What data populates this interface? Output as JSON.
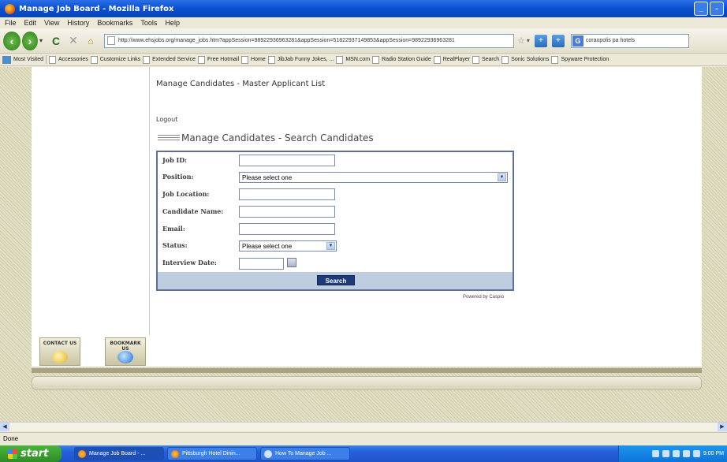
{
  "window": {
    "title": "Manage Job Board - Mozilla Firefox"
  },
  "menu": [
    "File",
    "Edit",
    "View",
    "History",
    "Bookmarks",
    "Tools",
    "Help"
  ],
  "address": {
    "url": "http://www.ehsjobs.org/manage_jobs.htm?appSession=98922936963281&appSession=51822937149853&appSession=98922936963281",
    "search": "coraopolis pa hotels"
  },
  "bookmarks": [
    "Most Visited",
    "Accessories",
    "Customize Links",
    "Extended Service",
    "Free Hotmail",
    "Home",
    "JibJab Funny Jokes, ...",
    "MSN.com",
    "Radio Station Guide",
    "RealPlayer",
    "Search",
    "Sonic Solutions",
    "Spyware Protection"
  ],
  "page": {
    "header": "Manage Candidates - Master Applicant List",
    "logout": "Logout",
    "section_title": "Manage Candidates - Search Candidates",
    "form": {
      "job_id_label": "Job ID:",
      "position_label": "Position:",
      "position_value": "Please select one",
      "location_label": "Job Location:",
      "candidate_label": "Candidate Name:",
      "email_label": "Email:",
      "status_label": "Status:",
      "status_value": "Please select one",
      "interview_label": "Interview Date:",
      "search_button": "Search"
    },
    "powered_by": "Powered by Caspio",
    "contact_label": "CONTACT US",
    "bookmark_label": "BOOKMARK US"
  },
  "status": "Done",
  "taskbar": {
    "start": "start",
    "tasks": [
      "Manage Job Board - ...",
      "Pittsburgh Hotel Dinin...",
      "How To Manage Job ..."
    ],
    "clock": "9:00 PM"
  }
}
